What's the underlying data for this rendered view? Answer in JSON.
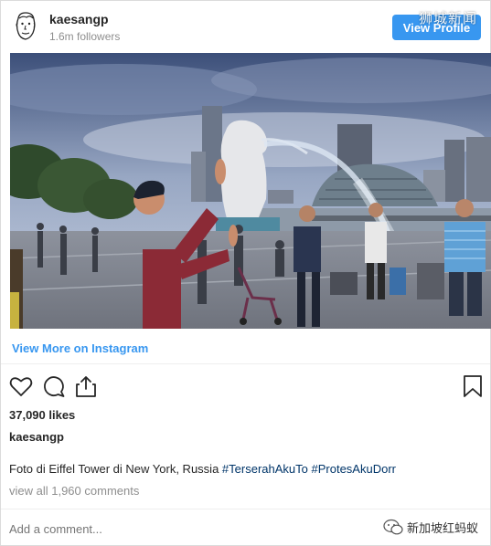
{
  "header": {
    "username": "kaesangp",
    "followers": "1.6m followers",
    "view_profile_label": "View Profile",
    "avatar_icon": "sketch-face-avatar-icon",
    "watermark": "狮城新闻"
  },
  "post": {
    "image": "photo-man-waving-at-merlion-statue",
    "view_more_label": "View More on Instagram",
    "likes": "37,090 likes",
    "owner": "kaesangp",
    "caption_text": "Foto di Eiffel Tower di New York, Russia",
    "hashtags": [
      "#TerserahAkuTo",
      "#ProtesAkuDorr"
    ],
    "view_comments": "view all 1,960 comments",
    "add_comment_placeholder": "Add a comment...",
    "watermark": "新加坡红蚂蚁"
  },
  "icons": {
    "like": "heart-icon",
    "comment": "comment-icon",
    "share": "share-icon",
    "save": "bookmark-icon"
  },
  "colors": {
    "accent": "#3897f0",
    "hashtag": "#003569",
    "muted": "#8e8e8e",
    "text": "#262626"
  }
}
